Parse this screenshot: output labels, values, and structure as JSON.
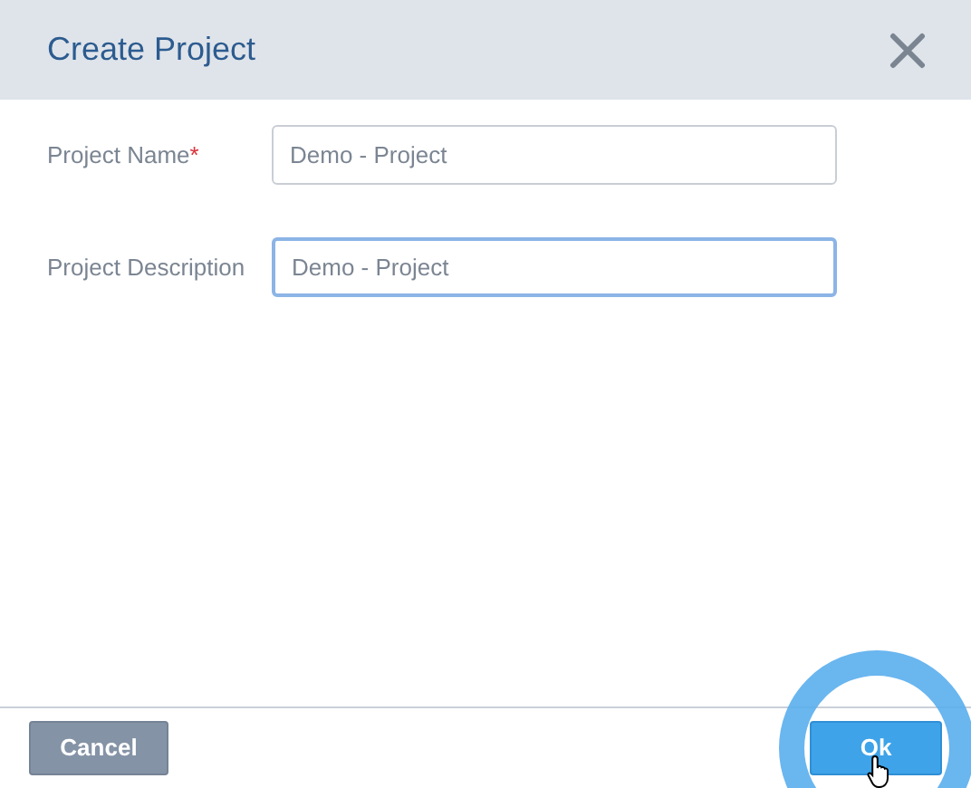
{
  "dialog": {
    "title": "Create Project"
  },
  "fields": [
    {
      "label": "Project Name",
      "required_mark": "*",
      "value": "Demo - Project",
      "focused": false
    },
    {
      "label": "Project Description",
      "value": "Demo - Project",
      "focused": true
    }
  ],
  "buttons": [
    {
      "label": "Cancel",
      "kind": "secondary"
    },
    {
      "label": "Ok",
      "kind": "primary"
    }
  ]
}
